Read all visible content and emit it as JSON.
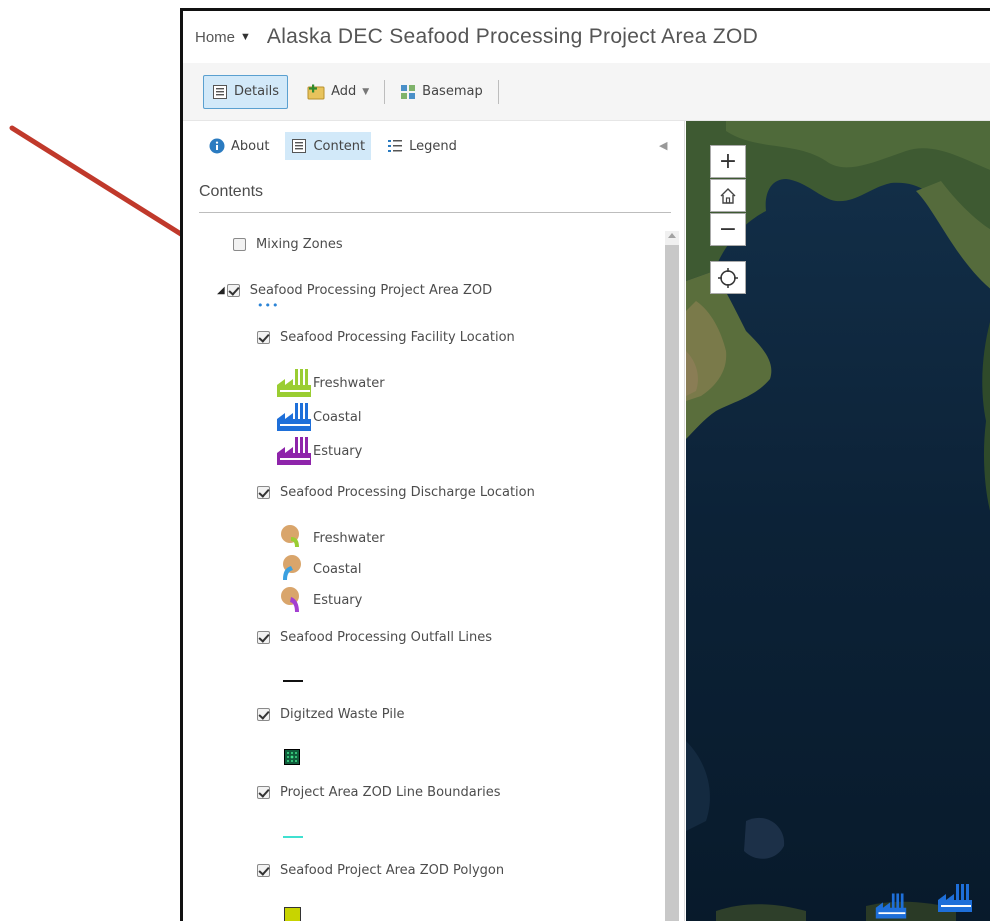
{
  "header": {
    "home_label": "Home",
    "title": "Alaska DEC Seafood Processing Project Area ZOD"
  },
  "toolbar": {
    "details_label": "Details",
    "add_label": "Add",
    "basemap_label": "Basemap"
  },
  "tabs": {
    "about_label": "About",
    "content_label": "Content",
    "legend_label": "Legend"
  },
  "contents": {
    "heading": "Contents",
    "layers": [
      {
        "label": "Mixing Zones",
        "checked": false
      },
      {
        "label": "Seafood Processing Project Area ZOD",
        "checked": true
      },
      {
        "label": "Seafood Processing Facility Location",
        "checked": true
      },
      {
        "label": "Seafood Processing Discharge Location",
        "checked": true
      },
      {
        "label": "Seafood Processing Outfall Lines",
        "checked": true
      },
      {
        "label": "Digitzed Waste Pile",
        "checked": true
      },
      {
        "label": "Project Area ZOD Line Boundaries",
        "checked": true
      },
      {
        "label": "Seafood Project Area ZOD Polygon",
        "checked": true
      }
    ],
    "facility_legend": [
      {
        "label": "Freshwater",
        "color": "#9acd32"
      },
      {
        "label": "Coastal",
        "color": "#1e6fd9"
      },
      {
        "label": "Estuary",
        "color": "#8e24aa"
      }
    ],
    "discharge_legend": [
      {
        "label": "Freshwater",
        "color": "#9acd32"
      },
      {
        "label": "Coastal",
        "color": "#3aa0e0"
      },
      {
        "label": "Estuary",
        "color": "#a33fd1"
      }
    ]
  },
  "colors": {
    "accent": "#d2e9f9",
    "arrow": "#c0392b",
    "line_boundary": "#40e0d0",
    "polygon_fill": "#c8d400"
  }
}
